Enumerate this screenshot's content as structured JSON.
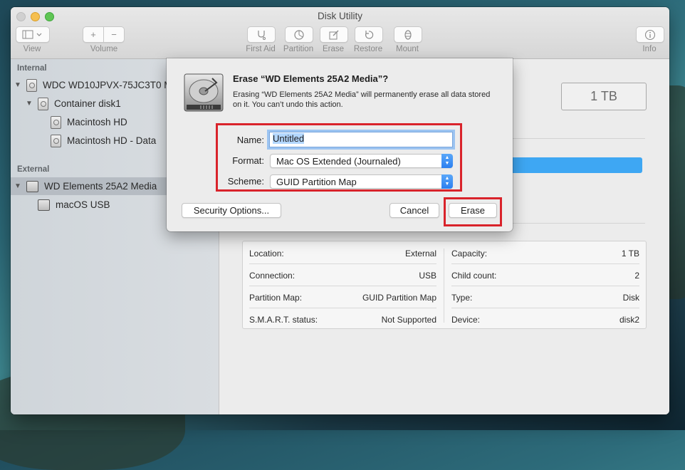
{
  "window": {
    "title": "Disk Utility"
  },
  "toolbar": {
    "view_label": "View",
    "volume_label": "Volume",
    "volume_add": "+",
    "volume_remove": "−",
    "first_aid_label": "First Aid",
    "partition_label": "Partition",
    "erase_label": "Erase",
    "restore_label": "Restore",
    "mount_label": "Mount",
    "info_label": "Info",
    "icons": [
      "sidebar-view-icon",
      "stethoscope-icon",
      "pie-chart-icon",
      "pencil-icon",
      "restore-arrow-icon",
      "eject-icon",
      "info-icon"
    ]
  },
  "sidebar": {
    "internal_header": "Internal",
    "external_header": "External",
    "items": [
      {
        "label": "WDC WD10JPVX-75JC3T0 M",
        "kind": "disk"
      },
      {
        "label": "Container disk1",
        "kind": "container"
      },
      {
        "label": "Macintosh HD",
        "kind": "volume"
      },
      {
        "label": "Macintosh HD - Data",
        "kind": "volume"
      },
      {
        "label": "WD Elements 25A2 Media",
        "kind": "external-disk",
        "selected": true
      },
      {
        "label": "macOS USB",
        "kind": "external-volume"
      }
    ]
  },
  "main": {
    "capacity_box": "1 TB",
    "info": {
      "left": [
        {
          "key": "Location:",
          "value": "External"
        },
        {
          "key": "Connection:",
          "value": "USB"
        },
        {
          "key": "Partition Map:",
          "value": "GUID Partition Map"
        },
        {
          "key": "S.M.A.R.T. status:",
          "value": "Not Supported"
        }
      ],
      "right": [
        {
          "key": "Capacity:",
          "value": "1 TB"
        },
        {
          "key": "Child count:",
          "value": "2"
        },
        {
          "key": "Type:",
          "value": "Disk"
        },
        {
          "key": "Device:",
          "value": "disk2"
        }
      ]
    }
  },
  "sheet": {
    "title": "Erase “WD Elements 25A2 Media”?",
    "message": "Erasing “WD Elements 25A2 Media” will permanently erase all data stored on it. You can’t undo this action.",
    "name_label": "Name:",
    "name_value": "Untitled",
    "format_label": "Format:",
    "format_value": "Mac OS Extended (Journaled)",
    "scheme_label": "Scheme:",
    "scheme_value": "GUID Partition Map",
    "security_button": "Security Options...",
    "cancel_button": "Cancel",
    "erase_button": "Erase",
    "highlight_color": "#d9232b",
    "accent_color": "#2b7ff0"
  }
}
